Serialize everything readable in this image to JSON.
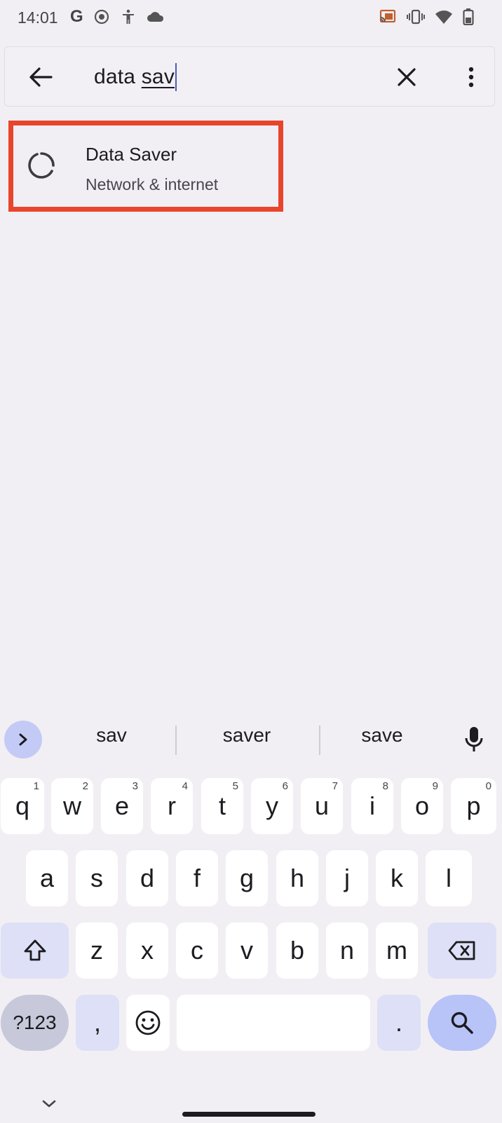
{
  "status_bar": {
    "time": "14:01",
    "google_letter": "G"
  },
  "search": {
    "query_committed": "data ",
    "query_composing": "sav"
  },
  "results": [
    {
      "title": "Data Saver",
      "subtitle": "Network & internet",
      "icon": "data-saver-icon"
    }
  ],
  "keyboard": {
    "suggestions": [
      "sav",
      "saver",
      "save"
    ],
    "rows": [
      [
        {
          "label": "q",
          "hint": "1"
        },
        {
          "label": "w",
          "hint": "2"
        },
        {
          "label": "e",
          "hint": "3"
        },
        {
          "label": "r",
          "hint": "4"
        },
        {
          "label": "t",
          "hint": "5"
        },
        {
          "label": "y",
          "hint": "6"
        },
        {
          "label": "u",
          "hint": "7"
        },
        {
          "label": "i",
          "hint": "8"
        },
        {
          "label": "o",
          "hint": "9"
        },
        {
          "label": "p",
          "hint": "0"
        }
      ],
      [
        {
          "label": "a"
        },
        {
          "label": "s"
        },
        {
          "label": "d"
        },
        {
          "label": "f"
        },
        {
          "label": "g"
        },
        {
          "label": "h"
        },
        {
          "label": "j"
        },
        {
          "label": "k"
        },
        {
          "label": "l"
        }
      ],
      [
        {
          "label": "z"
        },
        {
          "label": "x"
        },
        {
          "label": "c"
        },
        {
          "label": "v"
        },
        {
          "label": "b"
        },
        {
          "label": "n"
        },
        {
          "label": "m"
        }
      ]
    ],
    "symbols_label": "?123",
    "comma_label": ",",
    "period_label": "."
  },
  "colors": {
    "highlight_border": "#e8452c",
    "accent": "#b8c3f7",
    "background": "#f2eff4"
  }
}
